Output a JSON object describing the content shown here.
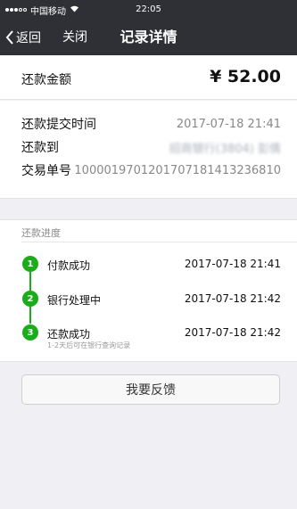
{
  "status_bar": {
    "carrier": "中国移动",
    "time": "22:05"
  },
  "nav": {
    "back_label": "返回",
    "close_label": "关闭",
    "title": "记录详情"
  },
  "amount": {
    "label": "还款金额",
    "value": "¥ 52.00"
  },
  "details": {
    "submit_time_label": "还款提交时间",
    "submit_time_value": "2017-07-18 21:41",
    "destination_label": "还款到",
    "destination_value": "招商银行(3804)  彭倩",
    "order_label": "交易单号",
    "order_value": "100001970120170718141323681​0"
  },
  "progress": {
    "header": "还款进度",
    "steps": [
      {
        "num": "1",
        "label": "付款成功",
        "time": "2017-07-18 21:41"
      },
      {
        "num": "2",
        "label": "银行处理中",
        "time": "2017-07-18 21:42"
      },
      {
        "num": "3",
        "label": "还款成功",
        "time": "2017-07-18 21:42",
        "sub": "1-2天后可在银行查询记录"
      }
    ]
  },
  "feedback_button": "我要反馈",
  "colors": {
    "nav_bg": "#2e3035",
    "accent_green": "#1aad19",
    "page_bg": "#efeff4"
  }
}
